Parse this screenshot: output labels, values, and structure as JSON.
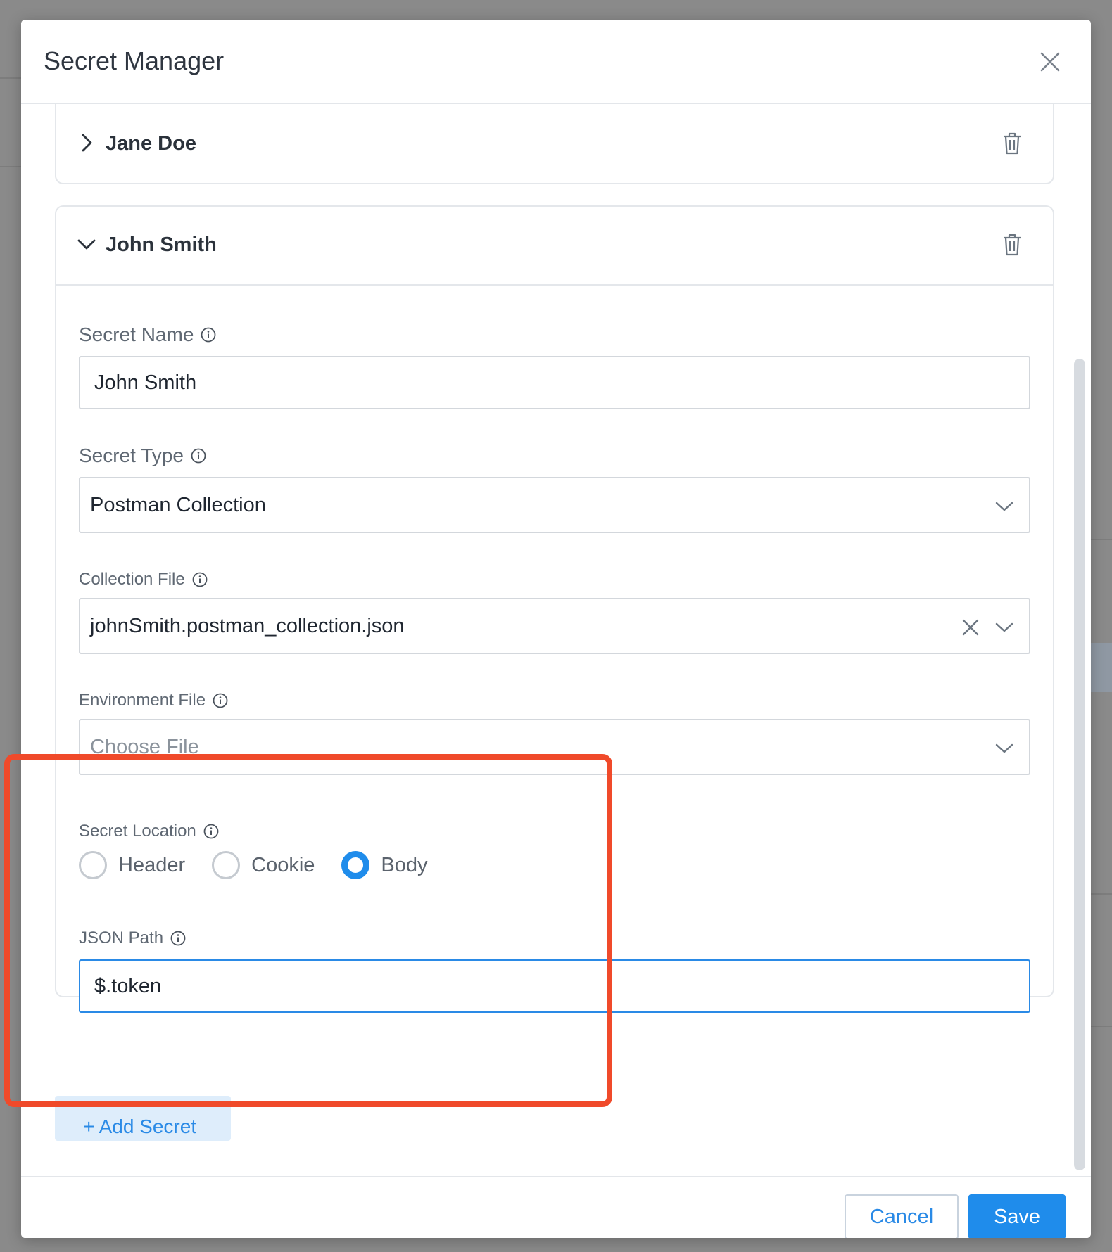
{
  "modal": {
    "title": "Secret Manager"
  },
  "secrets": [
    {
      "name": "Jane Doe",
      "expanded": false
    },
    {
      "name": "John Smith",
      "expanded": true
    }
  ],
  "form": {
    "secret_name": {
      "label": "Secret Name",
      "value": "John Smith"
    },
    "secret_type": {
      "label": "Secret Type",
      "value": "Postman Collection"
    },
    "collection_file": {
      "label": "Collection File",
      "value": "johnSmith.postman_collection.json"
    },
    "environment_file": {
      "label": "Environment File",
      "placeholder": "Choose File"
    },
    "secret_location": {
      "label": "Secret Location",
      "options": [
        "Header",
        "Cookie",
        "Body"
      ],
      "selected": "Body"
    },
    "json_path": {
      "label": "JSON Path",
      "value": "$.token"
    }
  },
  "add_secret_label": "+ Add Secret",
  "footer": {
    "cancel_label": "Cancel",
    "save_label": "Save"
  },
  "colors": {
    "accent": "#1f8ceb",
    "highlight": "#f04a2a"
  }
}
